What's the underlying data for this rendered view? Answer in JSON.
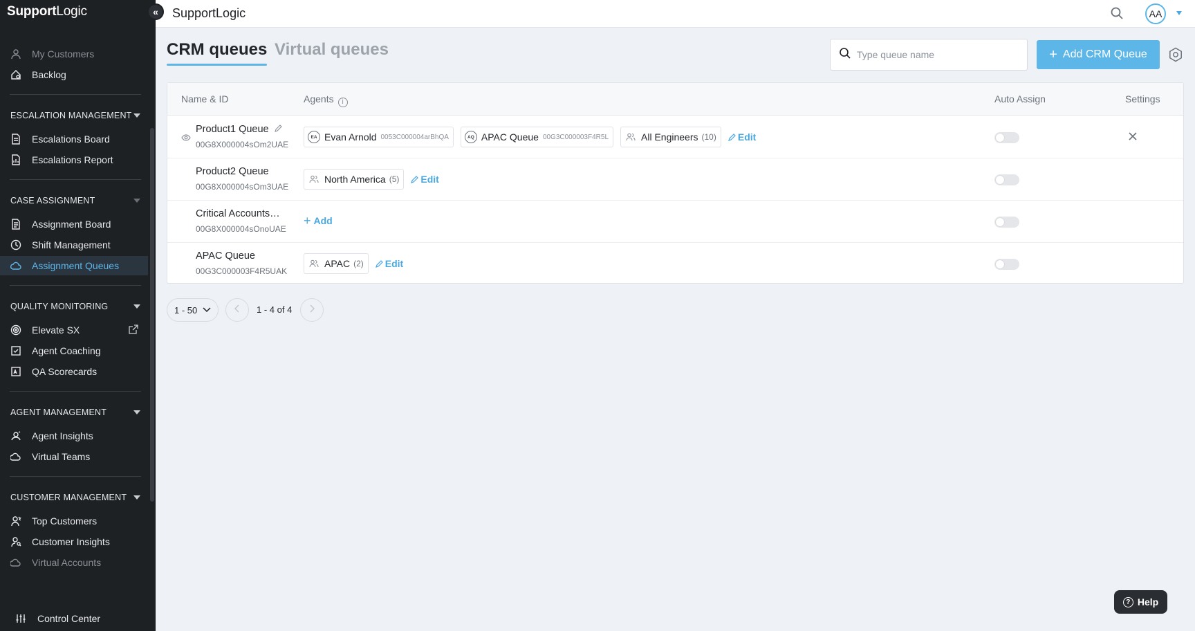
{
  "brand": {
    "bold": "Support",
    "regular": "Logic"
  },
  "collapse_icon": "«",
  "topbar": {
    "title": "SupportLogic",
    "avatar": "AA"
  },
  "sidebar": {
    "top_items": [
      {
        "label": "My Customers",
        "icon": "user-icon"
      },
      {
        "label": "Backlog",
        "icon": "home-icon"
      }
    ],
    "sections": {
      "escalation": {
        "title": "ESCALATION MANAGEMENT",
        "items": [
          "Escalations Board",
          "Escalations Report"
        ]
      },
      "case": {
        "title": "CASE ASSIGNMENT",
        "items": [
          "Assignment Board",
          "Shift Management",
          "Assignment Queues"
        ]
      },
      "quality": {
        "title": "QUALITY MONITORING",
        "items": [
          "Elevate SX",
          "Agent Coaching",
          "QA Scorecards"
        ]
      },
      "agent": {
        "title": "AGENT MANAGEMENT",
        "items": [
          "Agent Insights",
          "Virtual Teams"
        ]
      },
      "customer": {
        "title": "CUSTOMER MANAGEMENT",
        "items": [
          "Top Customers",
          "Customer Insights",
          "Virtual Accounts"
        ]
      }
    },
    "bottom": "Control Center"
  },
  "tabs": {
    "crm": "CRM queues",
    "virtual": "Virtual queues"
  },
  "search": {
    "placeholder": "Type queue name"
  },
  "add_button": "Add CRM Queue",
  "table": {
    "headers": {
      "name": "Name & ID",
      "agents": "Agents",
      "auto_assign": "Auto Assign",
      "settings": "Settings"
    },
    "rows": [
      {
        "name": "Product1 Queue",
        "id": "00G8X000004sOm2UAE",
        "chips": [
          {
            "badge": "EA",
            "label": "Evan Arnold",
            "sub": "0053C000004arBhQA"
          },
          {
            "badge": "AQ",
            "label": "APAC Queue",
            "sub": "00G3C000003F4R5L"
          },
          {
            "label": "All Engineers",
            "count": "(10)"
          }
        ],
        "action": "Edit",
        "auto_assign": false
      },
      {
        "name": "Product2 Queue",
        "id": "00G8X000004sOm3UAE",
        "chips": [
          {
            "label": "North America",
            "count": "(5)"
          }
        ],
        "action": "Edit",
        "auto_assign": false
      },
      {
        "name": "Critical Accounts…",
        "id": "00G8X000004sOnoUAE",
        "action": "Add",
        "auto_assign": false
      },
      {
        "name": "APAC Queue",
        "id": "00G3C000003F4R5UAK",
        "chips": [
          {
            "label": "APAC",
            "count": "(2)"
          }
        ],
        "action": "Edit",
        "auto_assign": false
      }
    ]
  },
  "pagination": {
    "page_size": "1 - 50",
    "info": "1 - 4 of 4"
  },
  "help": "Help",
  "colors": {
    "accent": "#5db6e8",
    "sidebar_bg": "#1e2124",
    "active_bg": "#2b3540"
  }
}
